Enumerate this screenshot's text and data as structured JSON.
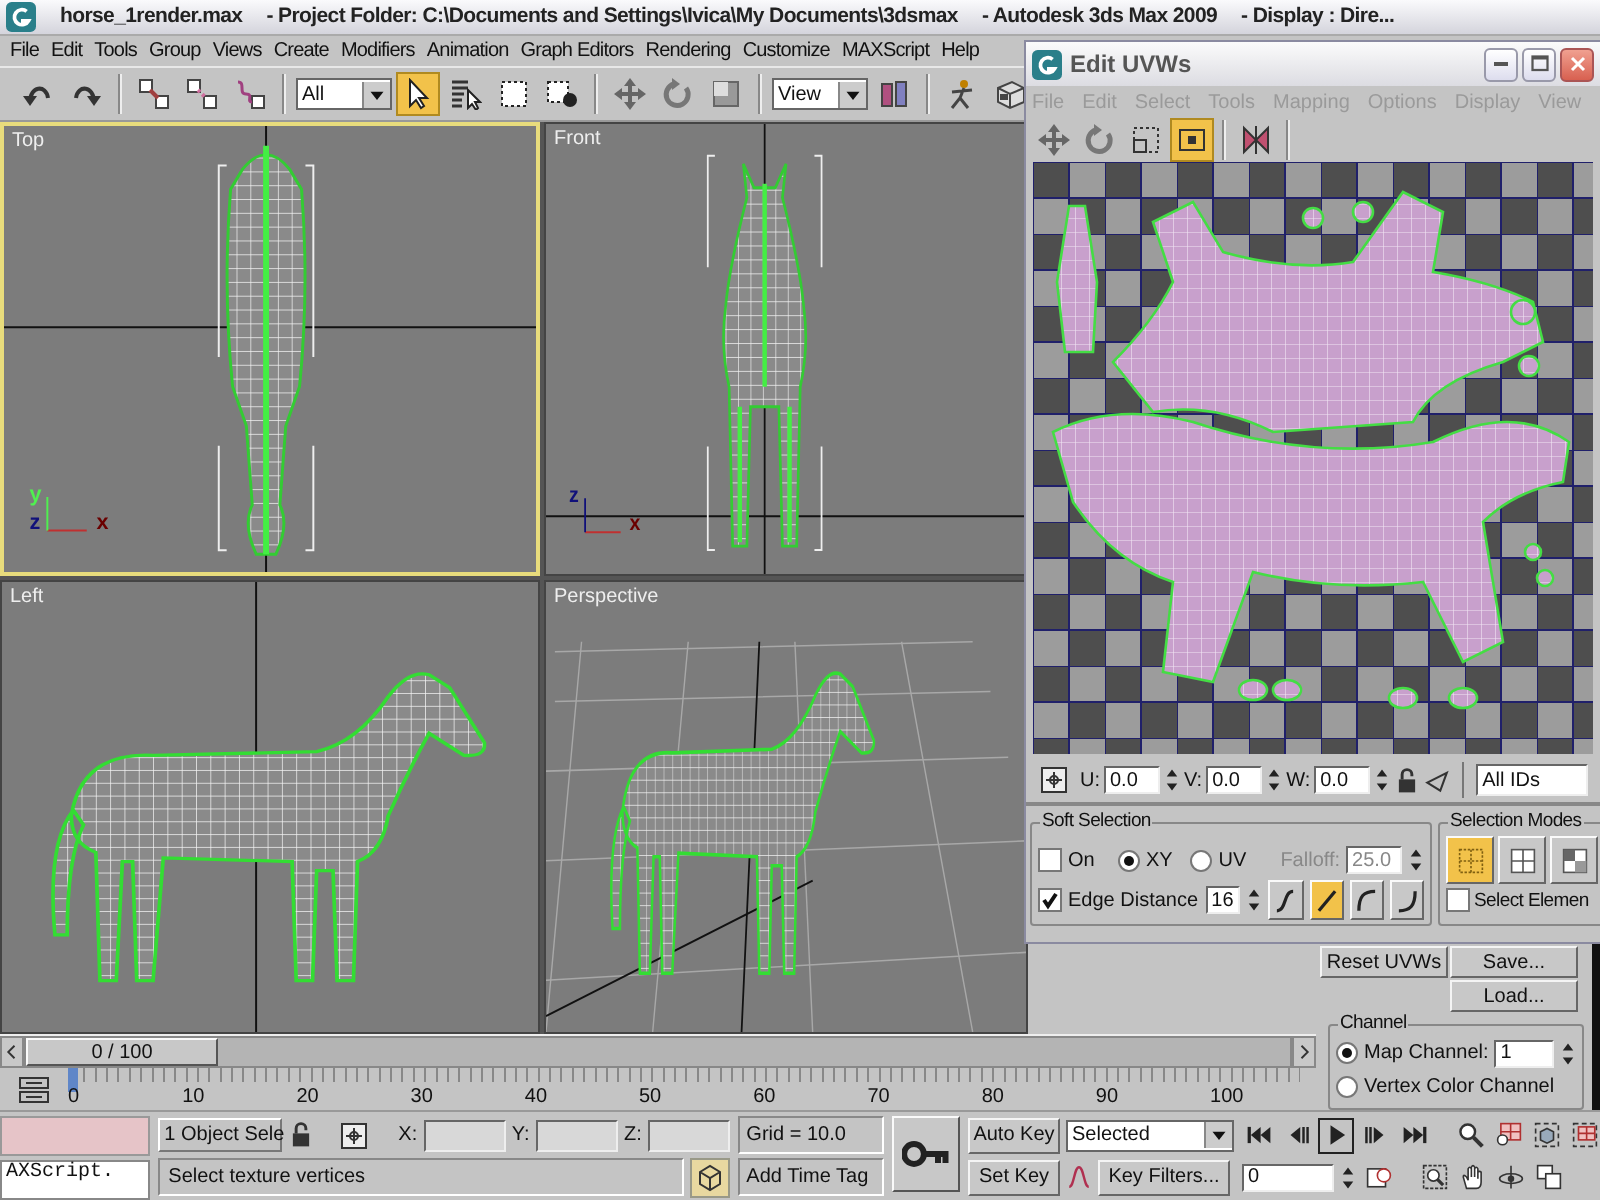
{
  "window": {
    "title": [
      "horse_1render.max",
      "- Project Folder: C:\\Documents and Settings\\Ivica\\My Documents\\3dsmax",
      "- Autodesk 3ds Max  2009",
      "- Display : Dire..."
    ]
  },
  "menu": [
    "File",
    "Edit",
    "Tools",
    "Group",
    "Views",
    "Create",
    "Modifiers",
    "Animation",
    "Graph Editors",
    "Rendering",
    "Customize",
    "MAXScript",
    "Help"
  ],
  "toolbar": {
    "items": [
      {
        "kind": "tool",
        "selected": false
      },
      {
        "kind": "tool",
        "selected": false
      },
      {
        "kind": "tool",
        "selected": false
      },
      {
        "kind": "tool",
        "selected": false
      },
      {
        "kind": "tool",
        "selected": false
      },
      {
        "kind": "dropdown",
        "value": "All"
      },
      {
        "kind": "tool",
        "selected": true
      },
      {
        "kind": "tool",
        "selected": false
      },
      {
        "kind": "tool",
        "selected": false
      },
      {
        "kind": "tool",
        "selected": false
      },
      {
        "kind": "tool",
        "selected": false
      },
      {
        "kind": "tool",
        "selected": false
      },
      {
        "kind": "tool",
        "selected": false
      },
      {
        "kind": "dropdown",
        "value": "View"
      },
      {
        "kind": "tool",
        "selected": false
      },
      {
        "kind": "tool",
        "selected": false
      },
      {
        "kind": "tool",
        "selected": false
      }
    ]
  },
  "viewports": [
    {
      "label": "Top",
      "active": true,
      "axes": [
        {
          "label": "y",
          "color": "#50f050"
        },
        {
          "label": "z",
          "color": "#10107a"
        },
        {
          "label": "x",
          "color": "#6a0000"
        }
      ]
    },
    {
      "label": "Front",
      "active": false,
      "axes": [
        {
          "label": "z",
          "color": "#10107a"
        },
        {
          "label": "x",
          "color": "#6a0000"
        }
      ]
    },
    {
      "label": "Left",
      "active": false
    },
    {
      "label": "Perspective",
      "active": false
    }
  ],
  "uv_editor": {
    "title": "Edit UVWs",
    "menu": [
      {
        "label": "File",
        "disabled": true
      },
      {
        "label": "Edit",
        "disabled": true
      },
      {
        "label": "Select",
        "disabled": true
      },
      {
        "label": "Tools",
        "disabled": true
      },
      {
        "label": "Mapping",
        "disabled": true
      },
      {
        "label": "Options",
        "disabled": true
      },
      {
        "label": "Display",
        "disabled": true
      },
      {
        "label": "View",
        "disabled": true
      }
    ],
    "tools": [
      {
        "selected": false
      },
      {
        "selected": false
      },
      {
        "selected": false
      },
      {
        "selected": true
      },
      {
        "selected": false
      }
    ],
    "coordinates": [
      {
        "label": "U:",
        "value": "0.0"
      },
      {
        "label": "V:",
        "value": "0.0"
      },
      {
        "label": "W:",
        "value": "0.0"
      }
    ],
    "id_filter": "All IDs",
    "soft_selection": {
      "title": "Soft Selection",
      "on": {
        "label": "On",
        "checked": false
      },
      "space": [
        {
          "label": "XY",
          "selected": true
        },
        {
          "label": "UV",
          "selected": false
        }
      ],
      "falloff": {
        "label": "Falloff:",
        "value": "25.0",
        "disabled": true
      },
      "edge_distance": {
        "label": "Edge Distance",
        "checked": true,
        "value": "16"
      },
      "curves": [
        {
          "selected": false
        },
        {
          "selected": true
        },
        {
          "selected": false
        },
        {
          "selected": false
        }
      ]
    },
    "selection_modes": {
      "title": "Selection Modes",
      "modes": [
        {
          "selected": true
        },
        {
          "selected": false
        },
        {
          "selected": false
        }
      ],
      "select_element": {
        "label": "Select Elemen",
        "checked": false
      }
    }
  },
  "command_panel": {
    "buttons": [
      "Reset UVWs",
      "Save...",
      "Load..."
    ],
    "channel": {
      "title": "Channel",
      "options": [
        {
          "label": "Map Channel:",
          "selected": true,
          "value": "1"
        },
        {
          "label": "Vertex Color Channel",
          "selected": false
        }
      ]
    }
  },
  "time_slider": {
    "label": "0 / 100",
    "level": 0
  },
  "track_bar": {
    "ticks": [
      "0",
      "10",
      "20",
      "30",
      "40",
      "50",
      "60",
      "70",
      "80",
      "90",
      "100"
    ],
    "level": 0
  },
  "status_bar": {
    "listener": "AXScript.",
    "selection": "1 Object Sele",
    "coordinates": [
      "X:",
      "Y:",
      "Z:"
    ],
    "grid": "Grid = 10.0",
    "prompt": "Select texture vertices",
    "time_tag": "Add Time Tag",
    "auto_key": {
      "label": "Auto Key",
      "on": false
    },
    "key_mode": "Selected",
    "set_key": "Set Key",
    "key_filters": "Key Filters...",
    "frame": "0"
  }
}
